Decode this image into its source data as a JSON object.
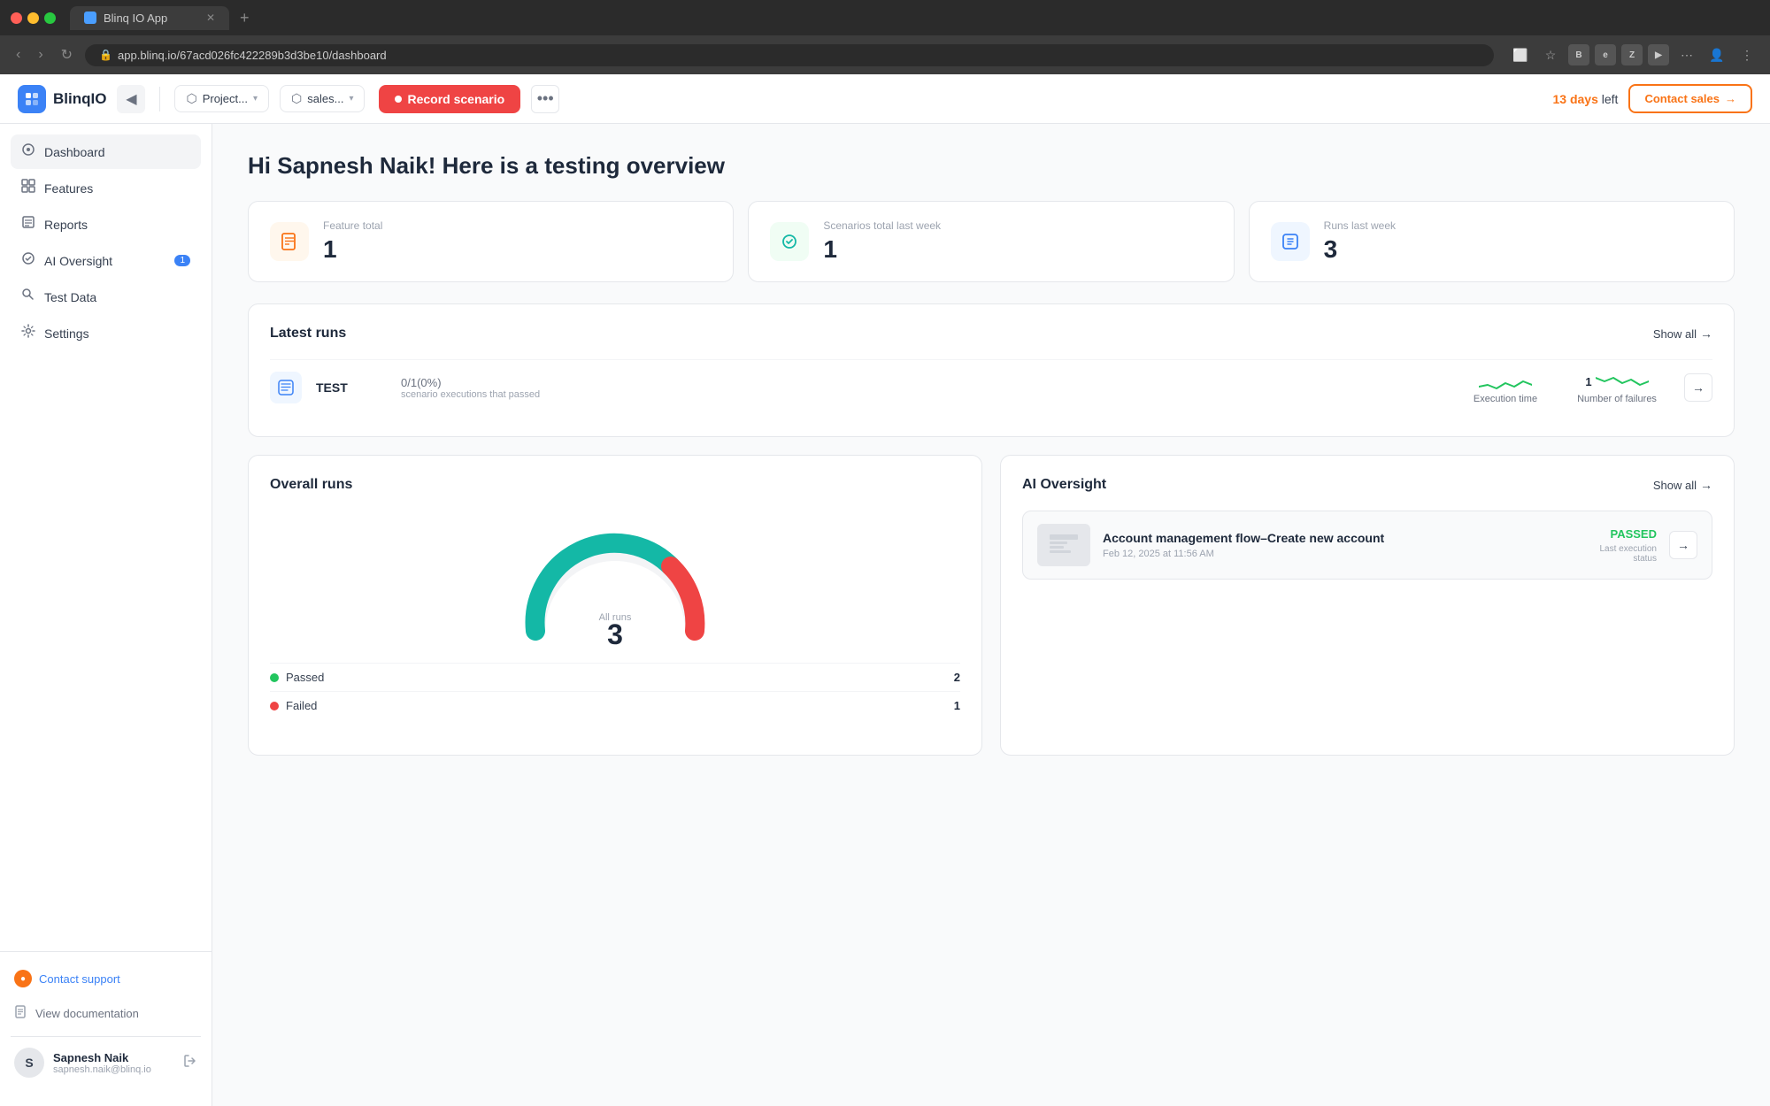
{
  "browser": {
    "tab_title": "Blinq IO App",
    "address": "app.blinq.io/67acd026fc422289b3d3be10/dashboard",
    "new_tab": "+"
  },
  "topbar": {
    "logo_text": "BlinqIO",
    "logo_letter": "B",
    "toggle_icon": "◀",
    "project_label": "Project...",
    "sales_label": "sales...",
    "record_button": "Record scenario",
    "more_icon": "•••",
    "days_left": "13 days",
    "days_suffix": "left",
    "contact_sales": "Contact sales",
    "contact_arrow": "→"
  },
  "sidebar": {
    "items": [
      {
        "label": "Dashboard",
        "icon": "⊙",
        "active": true
      },
      {
        "label": "Features",
        "icon": "⊞",
        "active": false
      },
      {
        "label": "Reports",
        "icon": "☰",
        "active": false
      },
      {
        "label": "AI Oversight",
        "icon": "⚙",
        "active": false,
        "badge": "1"
      },
      {
        "label": "Test Data",
        "icon": "🔍",
        "active": false
      },
      {
        "label": "Settings",
        "icon": "⚙",
        "active": false
      }
    ],
    "contact_support": "Contact support",
    "view_docs": "View documentation",
    "user_name": "Sapnesh Naik",
    "user_email": "sapnesh.naik@blinq.io",
    "user_initial": "S"
  },
  "main": {
    "greeting": "Hi Sapnesh Naik! Here is a testing overview",
    "stats": [
      {
        "label": "Feature total",
        "value": "1",
        "icon_type": "orange"
      },
      {
        "label": "Scenarios total last week",
        "value": "1",
        "icon_type": "teal"
      },
      {
        "label": "Runs last week",
        "value": "3",
        "icon_type": "blue"
      }
    ],
    "latest_runs": {
      "title": "Latest runs",
      "show_all": "Show all",
      "runs": [
        {
          "name": "TEST",
          "executions": "0/1(0%)",
          "execution_label": "scenario executions that passed",
          "execution_time_label": "Execution time",
          "failures_count": "1",
          "failures_label": "Number of failures"
        }
      ]
    },
    "overall_runs": {
      "title": "Overall runs",
      "total_label": "All runs",
      "total_value": "3",
      "legend": [
        {
          "label": "Passed",
          "count": "2",
          "color": "#22c55e"
        },
        {
          "label": "Failed",
          "count": "1",
          "color": "#ef4444"
        }
      ]
    },
    "ai_oversight": {
      "title": "AI Oversight",
      "show_all": "Show all",
      "items": [
        {
          "title": "Account management flow–Create new account",
          "date": "Feb 12, 2025 at 11:56 AM",
          "status": "PASSED",
          "status_label": "Last execution\nstatus"
        }
      ]
    }
  }
}
